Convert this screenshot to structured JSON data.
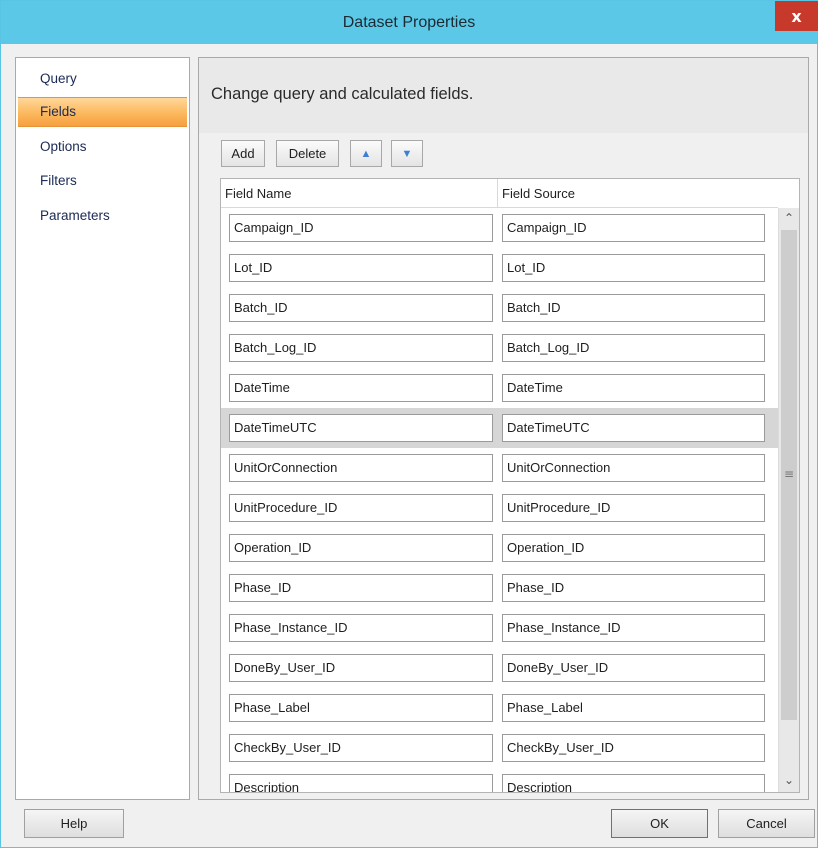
{
  "window": {
    "title": "Dataset Properties",
    "close_glyph": "x"
  },
  "sidebar": {
    "items": [
      {
        "label": "Query"
      },
      {
        "label": "Fields"
      },
      {
        "label": "Options"
      },
      {
        "label": "Filters"
      },
      {
        "label": "Parameters"
      }
    ],
    "selected": "Fields"
  },
  "panel": {
    "header": "Change query and calculated fields."
  },
  "toolbar": {
    "add_label": "Add",
    "delete_label": "Delete",
    "move_up_icon": "arrow-up-icon",
    "move_down_icon": "arrow-down-icon"
  },
  "grid": {
    "columns": [
      "Field Name",
      "Field Source"
    ],
    "rows": [
      {
        "name": "Campaign_ID",
        "source": "Campaign_ID"
      },
      {
        "name": "Lot_ID",
        "source": "Lot_ID"
      },
      {
        "name": "Batch_ID",
        "source": "Batch_ID"
      },
      {
        "name": "Batch_Log_ID",
        "source": "Batch_Log_ID"
      },
      {
        "name": "DateTime",
        "source": "DateTime"
      },
      {
        "name": "DateTimeUTC",
        "source": "DateTimeUTC"
      },
      {
        "name": "UnitOrConnection",
        "source": "UnitOrConnection"
      },
      {
        "name": "UnitProcedure_ID",
        "source": "UnitProcedure_ID"
      },
      {
        "name": "Operation_ID",
        "source": "Operation_ID"
      },
      {
        "name": "Phase_ID",
        "source": "Phase_ID"
      },
      {
        "name": "Phase_Instance_ID",
        "source": "Phase_Instance_ID"
      },
      {
        "name": "DoneBy_User_ID",
        "source": "DoneBy_User_ID"
      },
      {
        "name": "Phase_Label",
        "source": "Phase_Label"
      },
      {
        "name": "CheckBy_User_ID",
        "source": "CheckBy_User_ID"
      },
      {
        "name": "Description",
        "source": "Description"
      }
    ],
    "selected_row": "DateTimeUTC"
  },
  "footer": {
    "help_label": "Help",
    "ok_label": "OK",
    "cancel_label": "Cancel"
  },
  "colors": {
    "titlebar": "#5bc8e8",
    "close": "#c73a2b",
    "selection": "#fcb85d",
    "row_selected": "#d6d6d6",
    "arrow": "#3b7fd6"
  }
}
